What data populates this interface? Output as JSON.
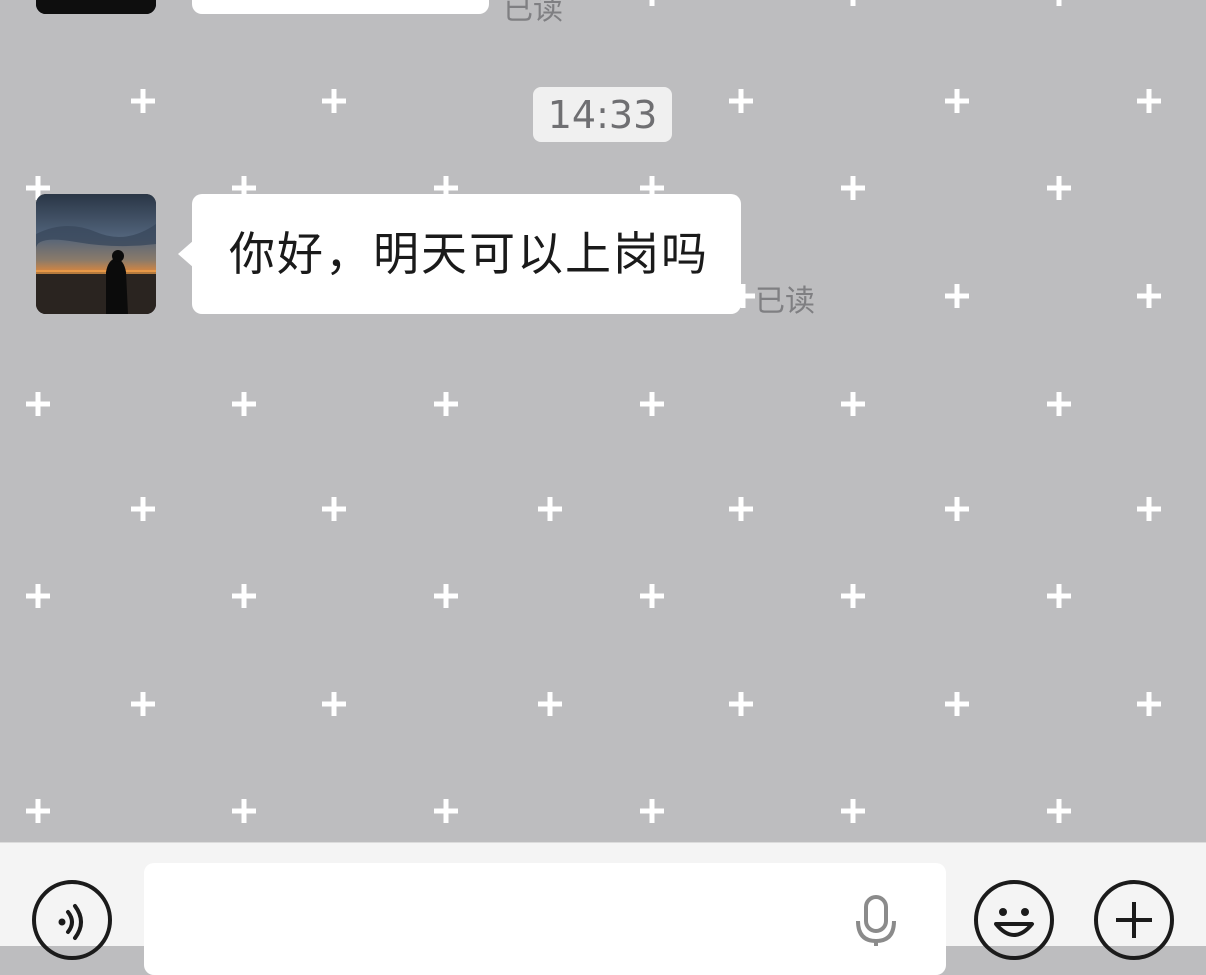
{
  "chat": {
    "top_partial_read_status": "已读",
    "timestamp": "14:33",
    "message": {
      "text": "你好，明天可以上岗吗",
      "read_status": "已读"
    }
  },
  "input_bar": {
    "text_value": "",
    "placeholder": ""
  },
  "icons": {
    "voice": "voice-toggle-icon",
    "mic": "microphone-icon",
    "emoji": "emoji-icon",
    "plus": "plus-icon"
  },
  "colors": {
    "chat_background": "#bdbdbf",
    "pattern_cross": "#ffffff",
    "bubble": "#ffffff",
    "input_bar_background": "#f4f4f4"
  }
}
